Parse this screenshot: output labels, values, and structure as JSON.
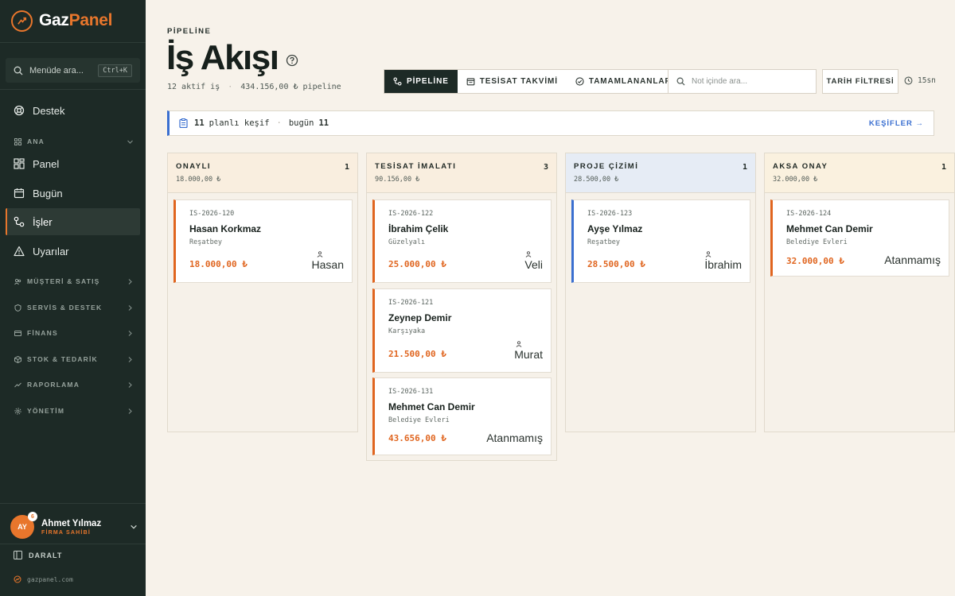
{
  "brand": {
    "name_part1": "Gaz",
    "name_part2": "Panel",
    "accent": "#e8762c"
  },
  "sidebar": {
    "search_placeholder": "Menüde ara...",
    "search_shortcut": "Ctrl+K",
    "support": "Destek",
    "group_main": "ANA",
    "items": [
      {
        "label": "Panel",
        "icon": "grid-icon"
      },
      {
        "label": "Bugün",
        "icon": "calendar-icon"
      },
      {
        "label": "İşler",
        "icon": "flow-icon",
        "active": true
      },
      {
        "label": "Uyarılar",
        "icon": "alert-icon"
      }
    ],
    "groups": [
      {
        "label": "MÜŞTERİ & SATIŞ",
        "icon": "users-icon"
      },
      {
        "label": "SERVİS & DESTEK",
        "icon": "shield-icon"
      },
      {
        "label": "FİNANS",
        "icon": "finance-icon"
      },
      {
        "label": "STOK & TEDARİK",
        "icon": "box-icon"
      },
      {
        "label": "RAPORLAMA",
        "icon": "trend-icon"
      },
      {
        "label": "YÖNETİM",
        "icon": "gear-icon"
      }
    ],
    "user": {
      "initials": "AY",
      "badge": "6",
      "name": "Ahmet Yılmaz",
      "role": "FİRMA SAHİBİ"
    },
    "collapse": "DARALT",
    "site": "gazpanel.com"
  },
  "header": {
    "eyebrow": "PİPELİNE",
    "title": "İş Akışı",
    "active_jobs": "12 aktif iş",
    "pipeline_total": "434.156,00 ₺ pipeline"
  },
  "toolbar": {
    "tabs": [
      {
        "label": "PİPELİNE",
        "active": true
      },
      {
        "label": "TESİSAT TAKVİMİ",
        "active": false
      },
      {
        "label": "TAMAMLANANLAR",
        "active": false
      }
    ],
    "note_search_placeholder": "Not içinde ara...",
    "date_filter": "TARİH FİLTRESİ",
    "refresh": "15sn"
  },
  "banner": {
    "count": "11",
    "planned": "planlı keşif",
    "today_label": "bugün",
    "today_count": "11",
    "link": "KEŞİFLER →",
    "accent": "#3a6fd0"
  },
  "columns": [
    {
      "title": "ONAYLI",
      "sum": "18.000,00 ₺",
      "count": "1",
      "cards": [
        {
          "id": "IS-2026-120",
          "name": "Hasan Korkmaz",
          "location": "Reşatbey",
          "amount": "18.000,00 ₺",
          "assignee": "Hasan"
        }
      ]
    },
    {
      "title": "TESİSAT İMALATI",
      "sum": "90.156,00 ₺",
      "count": "3",
      "cards": [
        {
          "id": "IS-2026-122",
          "name": "İbrahim Çelik",
          "location": "Güzelyalı",
          "amount": "25.000,00 ₺",
          "assignee": "Veli"
        },
        {
          "id": "IS-2026-121",
          "name": "Zeynep Demir",
          "location": "Karşıyaka",
          "amount": "21.500,00 ₺",
          "assignee": "Murat"
        },
        {
          "id": "IS-2026-131",
          "name": "Mehmet Can Demir",
          "location": "Belediye Evleri",
          "amount": "43.656,00 ₺",
          "assignee": "Atanmamış"
        }
      ]
    },
    {
      "title": "PROJE ÇİZİMİ",
      "sum": "28.500,00 ₺",
      "count": "1",
      "cards": [
        {
          "id": "IS-2026-123",
          "name": "Ayşe Yılmaz",
          "location": "Reşatbey",
          "amount": "28.500,00 ₺",
          "assignee": "İbrahim"
        }
      ]
    },
    {
      "title": "AKSA ONAY",
      "sum": "32.000,00 ₺",
      "count": "1",
      "cards": [
        {
          "id": "IS-2026-124",
          "name": "Mehmet Can Demir",
          "location": "Belediye Evleri",
          "amount": "32.000,00 ₺",
          "assignee": "Atanmamış"
        }
      ]
    }
  ]
}
